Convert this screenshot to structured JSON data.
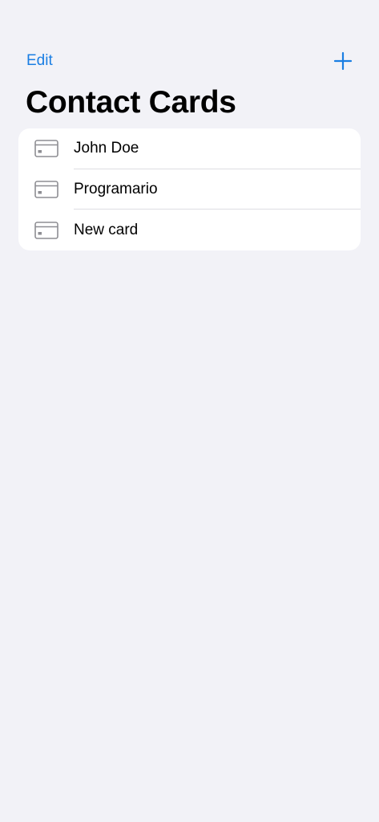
{
  "nav": {
    "edit_label": "Edit",
    "add_icon": "plus-icon"
  },
  "title": "Contact Cards",
  "cards": [
    {
      "name": "John Doe",
      "icon": "card-icon"
    },
    {
      "name": "Programario",
      "icon": "card-icon"
    },
    {
      "name": "New card",
      "icon": "card-icon"
    }
  ],
  "colors": {
    "accent": "#1a7ee3",
    "background": "#f2f2f7",
    "card_background": "#ffffff",
    "icon_gray": "#8e8e93"
  }
}
